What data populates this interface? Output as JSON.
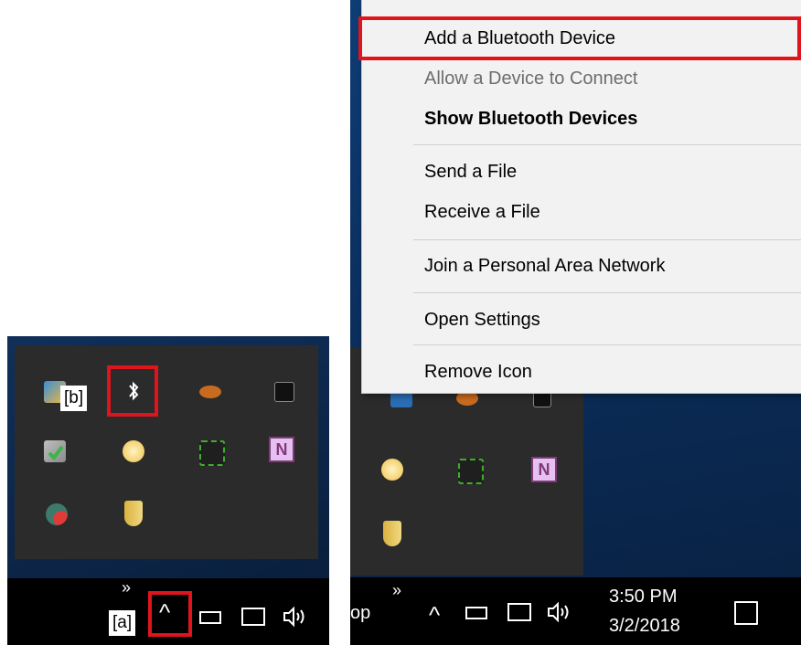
{
  "menu": {
    "items": [
      {
        "label": "Add a Bluetooth Device"
      },
      {
        "label": "Allow a Device to Connect"
      },
      {
        "label": "Show Bluetooth Devices"
      },
      {
        "label": "Send a File"
      },
      {
        "label": "Receive a File"
      },
      {
        "label": "Join a Personal Area Network"
      },
      {
        "label": "Open Settings"
      },
      {
        "label": "Remove Icon"
      }
    ]
  },
  "annotations": {
    "label_a": "[a]",
    "label_b": "[b]"
  },
  "taskbar": {
    "overflow_chevron": "»",
    "show_hidden_glyph": "^",
    "partial_text": "op",
    "time": "3:50 PM",
    "date": "3/2/2018"
  },
  "icons": {
    "bluetooth": "bluetooth-icon",
    "network": "network-icon",
    "volume": "volume-icon",
    "battery": "power-icon",
    "action_center": "action-center-icon"
  },
  "colors": {
    "highlight": "#e0141b",
    "menu_bg": "#f2f2f2",
    "flyout_bg": "#2b2b2b",
    "desktop": "#0c2a52"
  }
}
